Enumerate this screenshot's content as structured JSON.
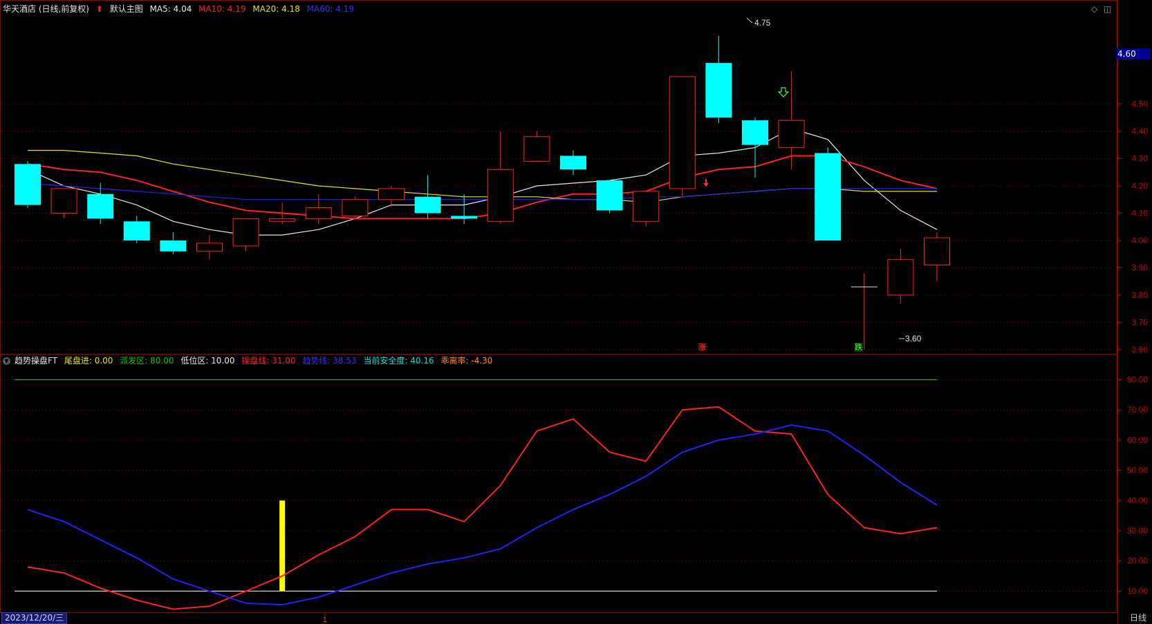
{
  "main_panel": {
    "stock_title": "华天酒店 (日线,前复权)",
    "chart_name": "默认主图",
    "ma5_label": "MA5: 4.04",
    "ma10_label": "MA10: 4.19",
    "ma20_label": "MA20: 4.18",
    "ma60_label": "MA60: 4.19",
    "current_price": "4.60",
    "high_marker": "4.75",
    "low_marker": "3.60",
    "marker_up": "涨",
    "marker_down": "跌"
  },
  "indicator_panel": {
    "name": "趋势操盘FT",
    "l1": "尾盘进: 0.00",
    "l2": "派发区: 80.00",
    "l3": "低位区: 10.00",
    "l4": "操盘线: 31.00",
    "l5": "趋势线: 38.53",
    "l6": "当前安全度: 40.16",
    "l7": "乖离率: -4.30"
  },
  "footer": {
    "date": "2023/12/20/三",
    "period": "日线",
    "cursor_marker": "1"
  },
  "colors": {
    "up": "#ff2020",
    "down": "#00ffff",
    "ma5": "#e8e8e8",
    "ma10": "#ff2020",
    "ma20": "#e6e600",
    "ma60": "#2020ff",
    "axis": "#cc0000",
    "grid": "#5a0000"
  },
  "chart_data": [
    {
      "type": "candlestick",
      "title": "华天酒店 (日线,前复权)",
      "y_ticks": [
        3.6,
        3.7,
        3.8,
        3.9,
        4.0,
        4.1,
        4.2,
        4.3,
        4.4,
        4.5
      ],
      "ylim": [
        3.585,
        4.83
      ],
      "candles": [
        {
          "open": 4.28,
          "high": 4.29,
          "low": 4.12,
          "close": 4.13
        },
        {
          "open": 4.1,
          "high": 4.19,
          "low": 4.08,
          "close": 4.19
        },
        {
          "open": 4.17,
          "high": 4.21,
          "low": 4.06,
          "close": 4.08
        },
        {
          "open": 4.07,
          "high": 4.09,
          "low": 3.99,
          "close": 4.0
        },
        {
          "open": 4.0,
          "high": 4.03,
          "low": 3.95,
          "close": 3.96
        },
        {
          "open": 3.96,
          "high": 4.02,
          "low": 3.93,
          "close": 3.99
        },
        {
          "open": 3.98,
          "high": 4.08,
          "low": 3.96,
          "close": 4.08
        },
        {
          "open": 4.07,
          "high": 4.14,
          "low": 4.06,
          "close": 4.08
        },
        {
          "open": 4.08,
          "high": 4.17,
          "low": 4.06,
          "close": 4.12
        },
        {
          "open": 4.09,
          "high": 4.16,
          "low": 4.08,
          "close": 4.15
        },
        {
          "open": 4.15,
          "high": 4.2,
          "low": 4.13,
          "close": 4.19
        },
        {
          "open": 4.16,
          "high": 4.24,
          "low": 4.08,
          "close": 4.1
        },
        {
          "open": 4.09,
          "high": 4.17,
          "low": 4.06,
          "close": 4.08
        },
        {
          "open": 4.07,
          "high": 4.4,
          "low": 4.06,
          "close": 4.26
        },
        {
          "open": 4.29,
          "high": 4.4,
          "low": 4.29,
          "close": 4.38
        },
        {
          "open": 4.31,
          "high": 4.33,
          "low": 4.24,
          "close": 4.26
        },
        {
          "open": 4.22,
          "high": 4.22,
          "low": 4.1,
          "close": 4.11
        },
        {
          "open": 4.07,
          "high": 4.18,
          "low": 4.05,
          "close": 4.18
        },
        {
          "open": 4.19,
          "high": 4.6,
          "low": 4.16,
          "close": 4.6
        },
        {
          "open": 4.65,
          "high": 4.75,
          "low": 4.43,
          "close": 4.45
        },
        {
          "open": 4.44,
          "high": 4.45,
          "low": 4.23,
          "close": 4.35
        },
        {
          "open": 4.34,
          "high": 4.62,
          "low": 4.26,
          "close": 4.44
        },
        {
          "open": 4.32,
          "high": 4.34,
          "low": 4.0,
          "close": 4.0
        },
        {
          "open": 3.83,
          "high": 3.88,
          "low": 3.6,
          "close": 3.83
        },
        {
          "open": 3.8,
          "high": 3.97,
          "low": 3.77,
          "close": 3.93
        },
        {
          "open": 3.91,
          "high": 4.03,
          "low": 3.85,
          "close": 4.01
        }
      ],
      "series": [
        {
          "name": "MA5",
          "color": "#e8e8e8",
          "values": [
            4.26,
            4.2,
            4.17,
            4.13,
            4.07,
            4.04,
            4.02,
            4.02,
            4.04,
            4.08,
            4.13,
            4.13,
            4.13,
            4.16,
            4.2,
            4.21,
            4.22,
            4.24,
            4.31,
            4.32,
            4.34,
            4.41,
            4.37,
            4.22,
            4.11,
            4.04
          ]
        },
        {
          "name": "MA10",
          "color": "#ff2020",
          "values": [
            4.28,
            4.26,
            4.25,
            4.22,
            4.18,
            4.14,
            4.11,
            4.1,
            4.09,
            4.08,
            4.08,
            4.08,
            4.08,
            4.1,
            4.14,
            4.17,
            4.17,
            4.18,
            4.23,
            4.26,
            4.27,
            4.31,
            4.31,
            4.27,
            4.22,
            4.19
          ]
        },
        {
          "name": "MA20",
          "color": "#e6e600",
          "values": [
            4.33,
            4.33,
            4.32,
            4.31,
            4.28,
            4.26,
            4.24,
            4.22,
            4.2,
            4.19,
            4.18,
            4.17,
            4.16,
            4.16,
            4.16,
            4.15,
            4.15,
            4.14,
            4.16,
            4.17,
            4.18,
            4.19,
            4.19,
            4.18,
            4.18,
            4.18
          ]
        },
        {
          "name": "MA60",
          "color": "#2020ff",
          "values": [
            4.21,
            4.2,
            4.19,
            4.18,
            4.17,
            4.16,
            4.15,
            4.15,
            4.15,
            4.15,
            4.15,
            4.15,
            4.15,
            4.15,
            4.15,
            4.15,
            4.15,
            4.16,
            4.16,
            4.17,
            4.18,
            4.19,
            4.19,
            4.19,
            4.19,
            4.19
          ]
        }
      ]
    },
    {
      "type": "line",
      "title": "趋势操盘FT",
      "y_ticks": [
        10,
        20,
        30,
        40,
        50,
        60,
        70,
        80
      ],
      "ylim": [
        3,
        84
      ],
      "levels": [
        {
          "name": "派发区",
          "value": 80,
          "color": "#00cc00"
        },
        {
          "name": "低位区",
          "value": 10,
          "color": "#ffffff"
        }
      ],
      "bar": {
        "index": 7,
        "from": 10,
        "to": 40,
        "color": "#ffff00"
      },
      "series": [
        {
          "name": "操盘线",
          "color": "#ff2020",
          "values": [
            18,
            16,
            11,
            7,
            4,
            5,
            10,
            15,
            22,
            28,
            37,
            37,
            33,
            45,
            63,
            67,
            56,
            53,
            70,
            71,
            63,
            62,
            42,
            31,
            29,
            31
          ]
        },
        {
          "name": "趋势线",
          "color": "#2020ff",
          "values": [
            37,
            33,
            27,
            21,
            14,
            10,
            6,
            5.5,
            8,
            12,
            16,
            19,
            21,
            24,
            31,
            37,
            42,
            48,
            56,
            60,
            62,
            65,
            63,
            55,
            46,
            38.5
          ]
        }
      ]
    }
  ]
}
